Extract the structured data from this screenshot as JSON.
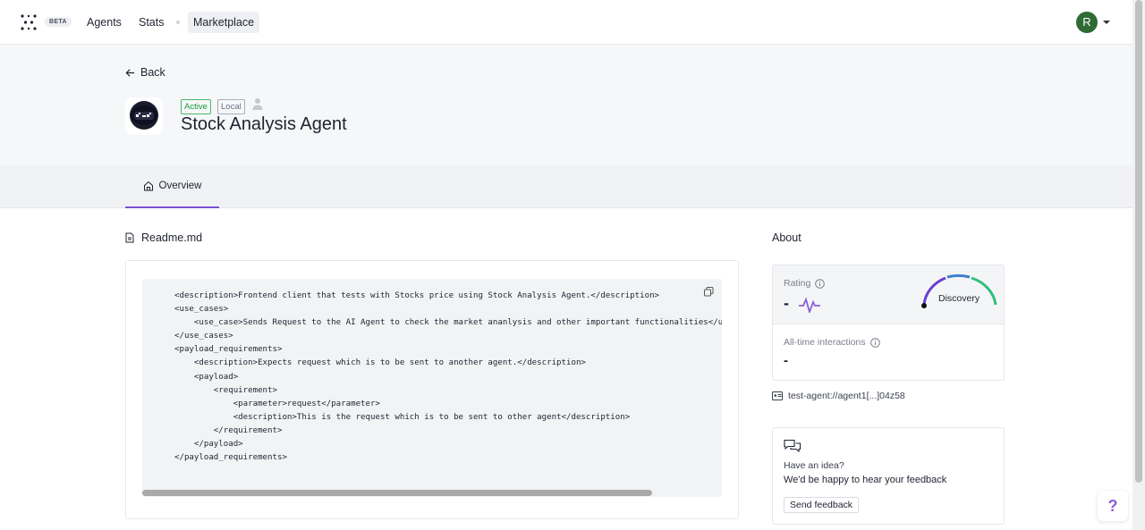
{
  "nav": {
    "beta": "BETA",
    "items": [
      {
        "label": "Agents"
      },
      {
        "label": "Stats"
      },
      {
        "label": "Marketplace"
      }
    ],
    "avatar_initial": "R"
  },
  "header": {
    "back_label": "Back",
    "badges": {
      "active": "Active",
      "local": "Local"
    },
    "title": "Stock Analysis Agent"
  },
  "tabs": {
    "overview": "Overview"
  },
  "readme": {
    "label": "Readme.md",
    "lines": [
      "<description>Frontend client that tests with Stocks price using Stock Analysis Agent.</description>",
      "<use_cases>",
      "    <use_case>Sends Request to the AI Agent to check the market ananlysis and other important functionalities</use_case>",
      "</use_cases>",
      "<payload_requirements>",
      "    <description>Expects request which is to be sent to another agent.</description>",
      "    <payload>",
      "        <requirement>",
      "            <parameter>request</parameter>",
      "            <description>This is the request which is to be sent to other agent</description>",
      "        </requirement>",
      "    </payload>",
      "</payload_requirements>"
    ]
  },
  "about": {
    "title": "About",
    "rating_label": "Rating",
    "rating_value": "-",
    "gauge_label": "Discovery",
    "interactions_label": "All-time interactions",
    "interactions_value": "-",
    "agent_address": "test-agent://agent1[...]04z58"
  },
  "feedback": {
    "title": "Have an idea?",
    "subtitle": "We'd be happy to hear your feedback",
    "button": "Send feedback"
  },
  "help": "?",
  "colors": {
    "accent": "#7b4fd4",
    "avatar": "#2f6b34",
    "active": "#1b9a3c"
  }
}
